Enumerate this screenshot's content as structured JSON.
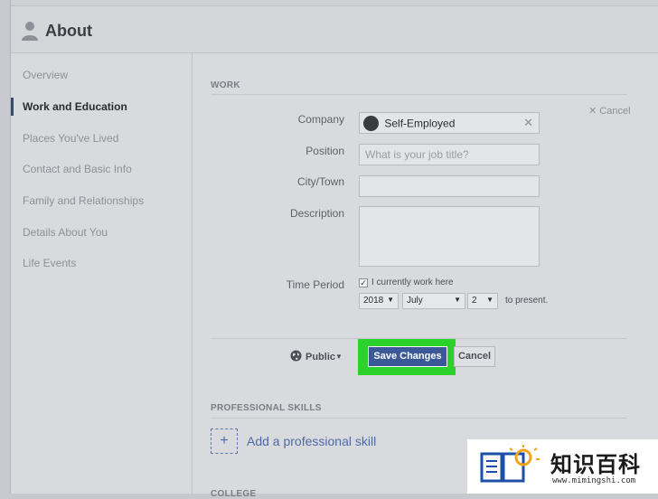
{
  "header": {
    "title": "About"
  },
  "sidebar": {
    "items": [
      {
        "label": "Overview"
      },
      {
        "label": "Work and Education"
      },
      {
        "label": "Places You've Lived"
      },
      {
        "label": "Contact and Basic Info"
      },
      {
        "label": "Family and Relationships"
      },
      {
        "label": "Details About You"
      },
      {
        "label": "Life Events"
      }
    ]
  },
  "work": {
    "section_title": "WORK",
    "cancel_link": "Cancel",
    "company_label": "Company",
    "company_value": "Self-Employed",
    "position_label": "Position",
    "position_placeholder": "What is your job title?",
    "city_label": "City/Town",
    "description_label": "Description",
    "time_period_label": "Time Period",
    "currently_work_label": "I currently work here",
    "year": "2018",
    "month": "July",
    "day": "2",
    "to_present": "to present.",
    "privacy": "Public",
    "save_label": "Save Changes",
    "cancel_label": "Cancel"
  },
  "skills": {
    "section_title": "PROFESSIONAL SKILLS",
    "add_label": "Add a professional skill"
  },
  "college": {
    "section_title": "COLLEGE"
  },
  "watermark": {
    "chinese": "知识百科",
    "url": "www.mimingshi.com"
  },
  "colors": {
    "accent": "#3b5998",
    "highlight": "#2bd22b",
    "link": "#4d6aa8"
  }
}
